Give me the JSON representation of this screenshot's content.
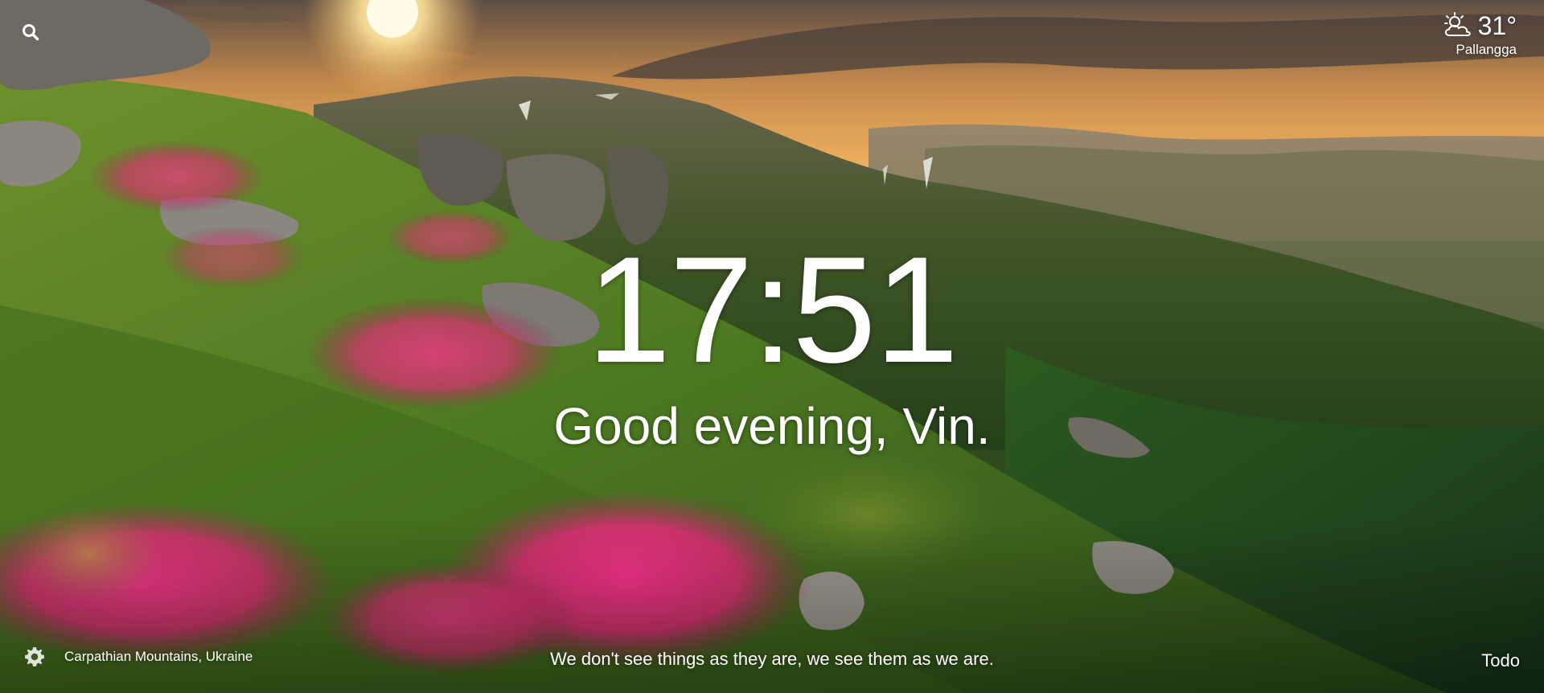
{
  "search": {
    "icon": "search-icon"
  },
  "weather": {
    "icon": "partly-cloudy-sun-icon",
    "temperature": "31°",
    "location": "Pallangga"
  },
  "center": {
    "time": "17:51",
    "greeting": "Good evening, Vin."
  },
  "footer": {
    "settings_icon": "gear-icon",
    "photo_location": "Carpathian Mountains, Ukraine",
    "quote": "We don't see things as they are, we see them as we are.",
    "todo_label": "Todo"
  },
  "colors": {
    "text": "#ffffff",
    "sky_warm": "#f2b35b",
    "grass": "#4f7a21",
    "flowers": "#d43b7f"
  }
}
